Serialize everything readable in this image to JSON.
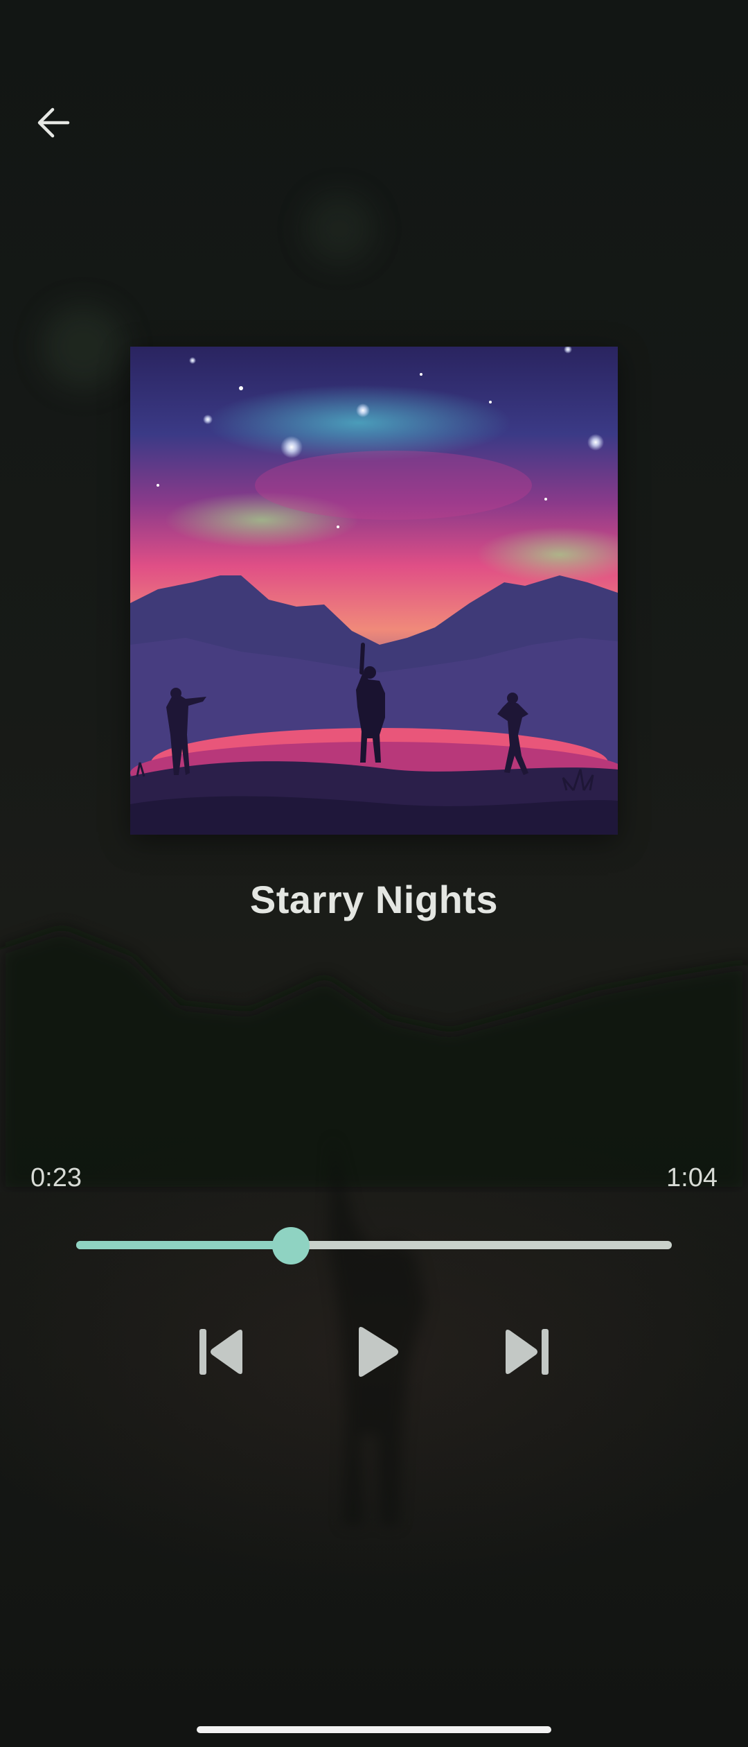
{
  "track": {
    "title": "Starry Nights"
  },
  "playback": {
    "current_time": "0:23",
    "total_time": "1:04",
    "progress": 0.36
  },
  "controls": {
    "back_icon": "arrow-left-icon",
    "prev_icon": "skip-previous-icon",
    "play_icon": "play-icon",
    "next_icon": "skip-next-icon"
  },
  "colors": {
    "accent": "#8fd3c2",
    "track": "#c9d1cb",
    "icon": "#c3c8c5",
    "text": "#e4e6e2"
  }
}
